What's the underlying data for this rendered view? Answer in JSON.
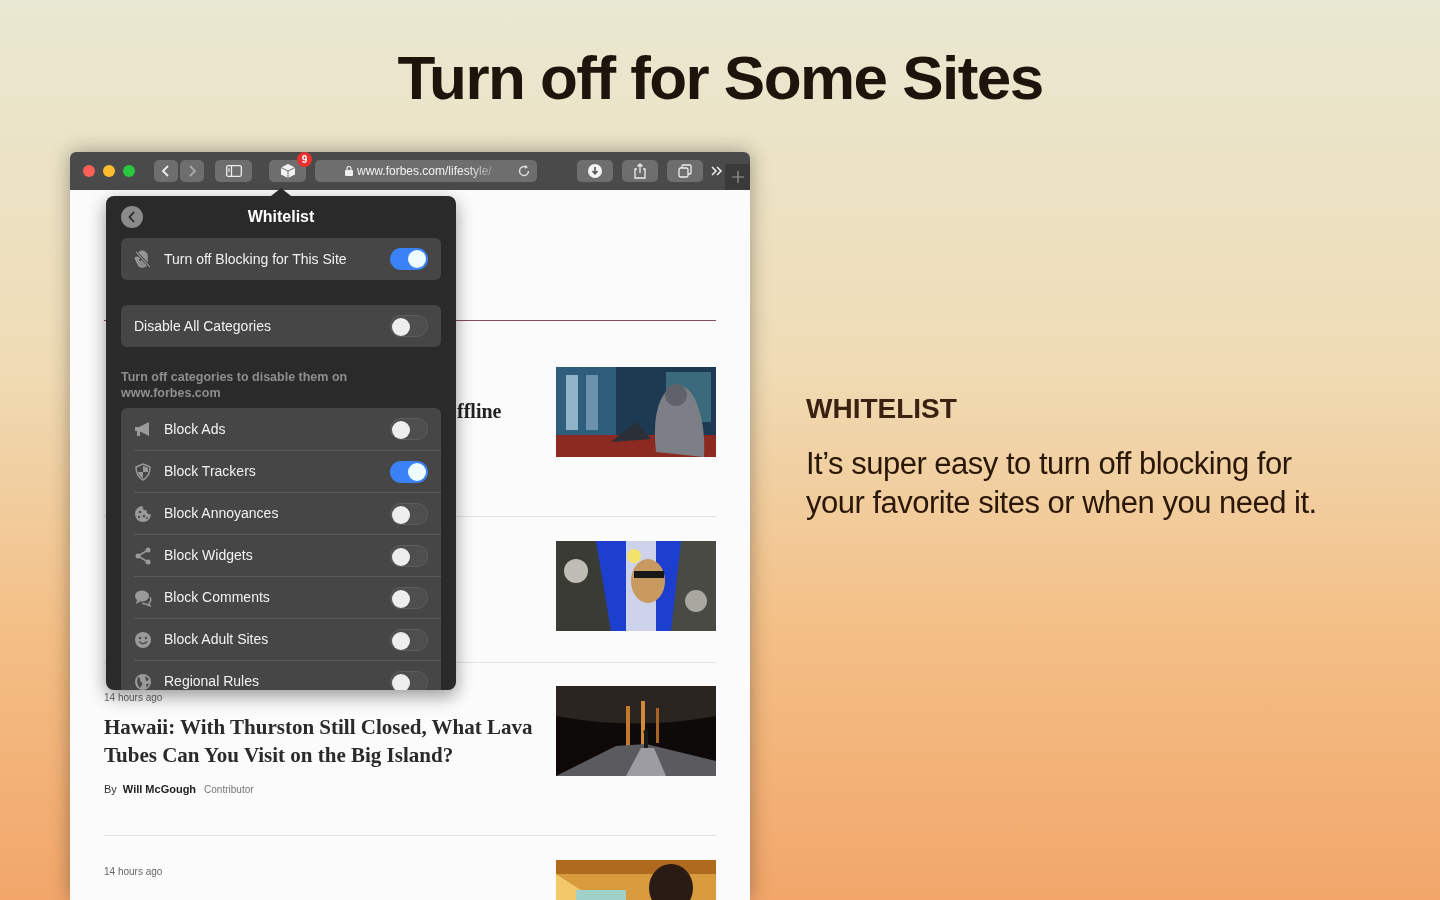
{
  "headline": "Turn off for Some Sites",
  "browser": {
    "extension_badge": "9",
    "url": "www.forbes.com/lifestyle/",
    "articles": [
      {
        "headline": "ffline",
        "picture": true
      },
      {
        "picture": true
      },
      {
        "time": "14 hours ago",
        "headline": "Hawaii: With Thurston Still Closed, What Lava Tubes Can You Visit on the Big Island?",
        "byline_prefix": "By",
        "author": "Will McGough",
        "role": "Contributor",
        "picture": true
      },
      {
        "time": "14 hours ago",
        "picture": true
      }
    ]
  },
  "popover": {
    "title": "Whitelist",
    "site_toggle": {
      "label": "Turn off Blocking for This Site",
      "on": true
    },
    "disable_all": {
      "label": "Disable All Categories",
      "on": false
    },
    "caption": "Turn off categories to disable them on\nwww.forbes.com",
    "categories": [
      {
        "label": "Block Ads",
        "on": false
      },
      {
        "label": "Block Trackers",
        "on": true
      },
      {
        "label": "Block Annoyances",
        "on": false
      },
      {
        "label": "Block Widgets",
        "on": false
      },
      {
        "label": "Block Comments",
        "on": false
      },
      {
        "label": "Block Adult Sites",
        "on": false
      },
      {
        "label": "Regional Rules",
        "on": false
      }
    ]
  },
  "side": {
    "heading": "WHITELIST",
    "body": "It’s super easy to turn off blocking for your favorite sites or when you need it."
  }
}
